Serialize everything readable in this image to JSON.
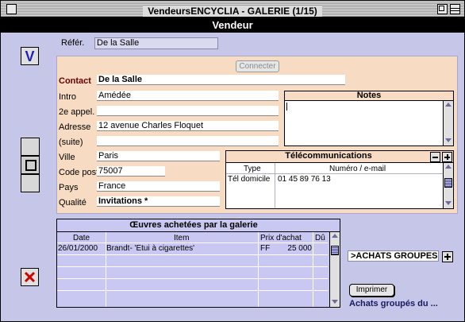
{
  "window": {
    "title": "VendeursENCYCLIA - GALERIE (1/15)"
  },
  "header": {
    "title": "Vendeur"
  },
  "ref": {
    "label": "Référ.",
    "value": "De la Salle"
  },
  "connect_button": "Connecter",
  "form": {
    "contact": {
      "label": "Contact",
      "value": "De la Salle"
    },
    "intro": {
      "label": "Intro",
      "value": "Amédée"
    },
    "appel2": {
      "label": "2e appel.",
      "value": ""
    },
    "adresse": {
      "label": "Adresse",
      "value": "12 avenue Charles Floquet"
    },
    "suite": {
      "label": "(suite)",
      "value": ""
    },
    "ville": {
      "label": "Ville",
      "value": "Paris"
    },
    "code": {
      "label": "Code post.",
      "value": "75007"
    },
    "pays": {
      "label": "Pays",
      "value": "France"
    },
    "qualite": {
      "label": "Qualité",
      "value": "Invitations *"
    }
  },
  "notes": {
    "title": "Notes"
  },
  "telecom": {
    "title": "Télécommunications",
    "columns": [
      "Type",
      "Numéro / e-mail"
    ],
    "rows": [
      {
        "type": "Tél domicile",
        "numero": "01 45 89 76 13"
      }
    ]
  },
  "oeuvres": {
    "title": "Œuvres achetées par la galerie",
    "columns": [
      "Date",
      "Item",
      "Prix d'achat",
      "Dû"
    ],
    "rows": [
      {
        "date": "26/01/2000",
        "item": "Brandt- 'Etui à cigarettes'",
        "currency": "FF",
        "prix": "25 000",
        "du": ""
      }
    ]
  },
  "achats": {
    "label": ">ACHATS GROUPES",
    "print_button": "Imprimer",
    "footer": "Achats groupés du ..."
  },
  "colors": {
    "background": "#c6c6e8",
    "form_panel": "#f7dcc3",
    "header": "#000000",
    "validate": "#2020c0",
    "cancel": "#d00000"
  },
  "icons": {
    "validate": "check-v-icon",
    "cancel": "x-cancel-icon",
    "toggle": "square-icon"
  }
}
